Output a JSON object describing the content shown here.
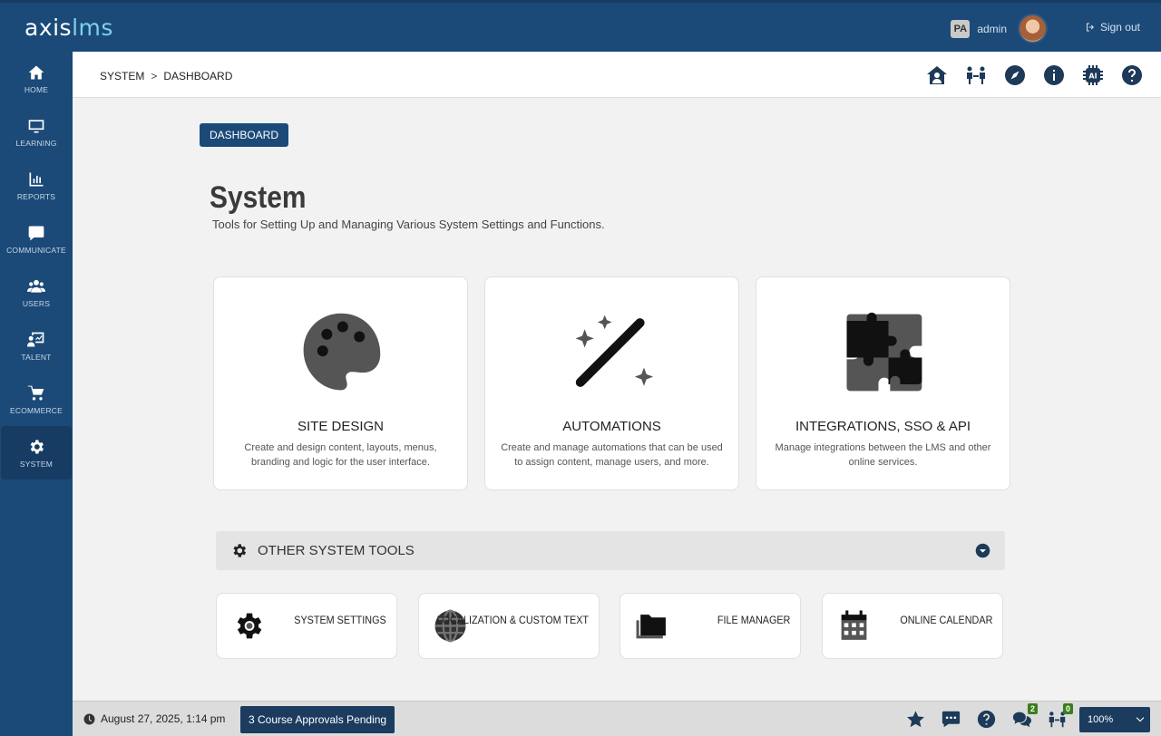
{
  "app": {
    "logo_main": "axis",
    "logo_accent": "lms"
  },
  "user": {
    "initials": "PA",
    "name": "admin",
    "signout_label": "Sign out"
  },
  "sidebar": {
    "items": [
      {
        "label": "HOME",
        "icon": "home-icon"
      },
      {
        "label": "LEARNING",
        "icon": "monitor-icon"
      },
      {
        "label": "REPORTS",
        "icon": "chart-icon"
      },
      {
        "label": "COMMUNICATE",
        "icon": "chat-icon"
      },
      {
        "label": "USERS",
        "icon": "users-icon"
      },
      {
        "label": "TALENT",
        "icon": "talent-icon"
      },
      {
        "label": "ECOMMERCE",
        "icon": "cart-icon"
      },
      {
        "label": "SYSTEM",
        "icon": "gear-icon",
        "active": true
      }
    ]
  },
  "breadcrumb": {
    "root": "SYSTEM",
    "separator": ">",
    "current": "DASHBOARD"
  },
  "header_icons": [
    "home-user-icon",
    "connect-icon",
    "compass-icon",
    "info-icon",
    "ai-chip-icon",
    "help-icon"
  ],
  "main": {
    "tag": "DASHBOARD",
    "title": "System",
    "subtitle": "Tools for Setting Up and Managing Various System Settings and Functions.",
    "cards": [
      {
        "title": "SITE DESIGN",
        "desc": "Create and design content, layouts, menus, branding and logic for the user interface.",
        "icon": "palette-icon"
      },
      {
        "title": "AUTOMATIONS",
        "desc": "Create and manage automations that can be used to assign content, manage users, and more.",
        "icon": "magic-wand-icon"
      },
      {
        "title": "INTEGRATIONS, SSO & API",
        "desc": "Manage integrations between the LMS and other online services.",
        "icon": "puzzle-icon"
      }
    ],
    "other_tools": {
      "label": "OTHER SYSTEM TOOLS",
      "items": [
        {
          "label": "SYSTEM SETTINGS",
          "icon": "gear-icon"
        },
        {
          "label": "LOCALIZATION & CUSTOM TEXT",
          "icon": "globe-icon"
        },
        {
          "label": "FILE MANAGER",
          "icon": "folder-icon"
        },
        {
          "label": "ONLINE CALENDAR",
          "icon": "calendar-icon"
        }
      ]
    }
  },
  "footer": {
    "date": "August 27, 2025, 1:14 pm",
    "pending": "3 Course Approvals Pending",
    "messages_count": "2",
    "connections_count": "0",
    "zoom": "100%"
  },
  "colors": {
    "primary": "#1b4a78",
    "accent": "#7fd0ee",
    "badge": "#3a7d1c"
  }
}
